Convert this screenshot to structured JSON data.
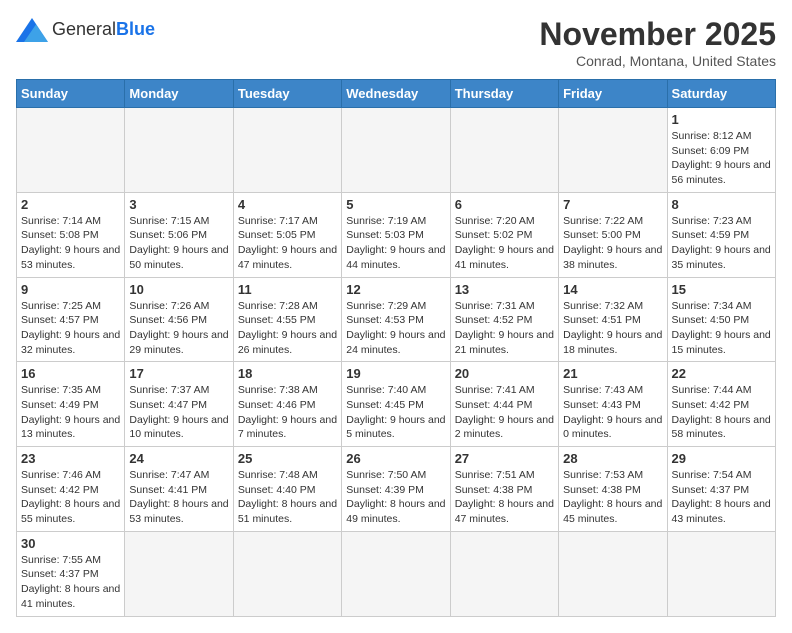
{
  "header": {
    "logo_text_normal": "General",
    "logo_text_bold": "Blue",
    "month": "November 2025",
    "location": "Conrad, Montana, United States"
  },
  "weekdays": [
    "Sunday",
    "Monday",
    "Tuesday",
    "Wednesday",
    "Thursday",
    "Friday",
    "Saturday"
  ],
  "weeks": [
    [
      {
        "day": "",
        "info": ""
      },
      {
        "day": "",
        "info": ""
      },
      {
        "day": "",
        "info": ""
      },
      {
        "day": "",
        "info": ""
      },
      {
        "day": "",
        "info": ""
      },
      {
        "day": "",
        "info": ""
      },
      {
        "day": "1",
        "info": "Sunrise: 8:12 AM\nSunset: 6:09 PM\nDaylight: 9 hours and 56 minutes."
      }
    ],
    [
      {
        "day": "2",
        "info": "Sunrise: 7:14 AM\nSunset: 5:08 PM\nDaylight: 9 hours and 53 minutes."
      },
      {
        "day": "3",
        "info": "Sunrise: 7:15 AM\nSunset: 5:06 PM\nDaylight: 9 hours and 50 minutes."
      },
      {
        "day": "4",
        "info": "Sunrise: 7:17 AM\nSunset: 5:05 PM\nDaylight: 9 hours and 47 minutes."
      },
      {
        "day": "5",
        "info": "Sunrise: 7:19 AM\nSunset: 5:03 PM\nDaylight: 9 hours and 44 minutes."
      },
      {
        "day": "6",
        "info": "Sunrise: 7:20 AM\nSunset: 5:02 PM\nDaylight: 9 hours and 41 minutes."
      },
      {
        "day": "7",
        "info": "Sunrise: 7:22 AM\nSunset: 5:00 PM\nDaylight: 9 hours and 38 minutes."
      },
      {
        "day": "8",
        "info": "Sunrise: 7:23 AM\nSunset: 4:59 PM\nDaylight: 9 hours and 35 minutes."
      }
    ],
    [
      {
        "day": "9",
        "info": "Sunrise: 7:25 AM\nSunset: 4:57 PM\nDaylight: 9 hours and 32 minutes."
      },
      {
        "day": "10",
        "info": "Sunrise: 7:26 AM\nSunset: 4:56 PM\nDaylight: 9 hours and 29 minutes."
      },
      {
        "day": "11",
        "info": "Sunrise: 7:28 AM\nSunset: 4:55 PM\nDaylight: 9 hours and 26 minutes."
      },
      {
        "day": "12",
        "info": "Sunrise: 7:29 AM\nSunset: 4:53 PM\nDaylight: 9 hours and 24 minutes."
      },
      {
        "day": "13",
        "info": "Sunrise: 7:31 AM\nSunset: 4:52 PM\nDaylight: 9 hours and 21 minutes."
      },
      {
        "day": "14",
        "info": "Sunrise: 7:32 AM\nSunset: 4:51 PM\nDaylight: 9 hours and 18 minutes."
      },
      {
        "day": "15",
        "info": "Sunrise: 7:34 AM\nSunset: 4:50 PM\nDaylight: 9 hours and 15 minutes."
      }
    ],
    [
      {
        "day": "16",
        "info": "Sunrise: 7:35 AM\nSunset: 4:49 PM\nDaylight: 9 hours and 13 minutes."
      },
      {
        "day": "17",
        "info": "Sunrise: 7:37 AM\nSunset: 4:47 PM\nDaylight: 9 hours and 10 minutes."
      },
      {
        "day": "18",
        "info": "Sunrise: 7:38 AM\nSunset: 4:46 PM\nDaylight: 9 hours and 7 minutes."
      },
      {
        "day": "19",
        "info": "Sunrise: 7:40 AM\nSunset: 4:45 PM\nDaylight: 9 hours and 5 minutes."
      },
      {
        "day": "20",
        "info": "Sunrise: 7:41 AM\nSunset: 4:44 PM\nDaylight: 9 hours and 2 minutes."
      },
      {
        "day": "21",
        "info": "Sunrise: 7:43 AM\nSunset: 4:43 PM\nDaylight: 9 hours and 0 minutes."
      },
      {
        "day": "22",
        "info": "Sunrise: 7:44 AM\nSunset: 4:42 PM\nDaylight: 8 hours and 58 minutes."
      }
    ],
    [
      {
        "day": "23",
        "info": "Sunrise: 7:46 AM\nSunset: 4:42 PM\nDaylight: 8 hours and 55 minutes."
      },
      {
        "day": "24",
        "info": "Sunrise: 7:47 AM\nSunset: 4:41 PM\nDaylight: 8 hours and 53 minutes."
      },
      {
        "day": "25",
        "info": "Sunrise: 7:48 AM\nSunset: 4:40 PM\nDaylight: 8 hours and 51 minutes."
      },
      {
        "day": "26",
        "info": "Sunrise: 7:50 AM\nSunset: 4:39 PM\nDaylight: 8 hours and 49 minutes."
      },
      {
        "day": "27",
        "info": "Sunrise: 7:51 AM\nSunset: 4:38 PM\nDaylight: 8 hours and 47 minutes."
      },
      {
        "day": "28",
        "info": "Sunrise: 7:53 AM\nSunset: 4:38 PM\nDaylight: 8 hours and 45 minutes."
      },
      {
        "day": "29",
        "info": "Sunrise: 7:54 AM\nSunset: 4:37 PM\nDaylight: 8 hours and 43 minutes."
      }
    ],
    [
      {
        "day": "30",
        "info": "Sunrise: 7:55 AM\nSunset: 4:37 PM\nDaylight: 8 hours and 41 minutes."
      },
      {
        "day": "",
        "info": ""
      },
      {
        "day": "",
        "info": ""
      },
      {
        "day": "",
        "info": ""
      },
      {
        "day": "",
        "info": ""
      },
      {
        "day": "",
        "info": ""
      },
      {
        "day": "",
        "info": ""
      }
    ]
  ]
}
